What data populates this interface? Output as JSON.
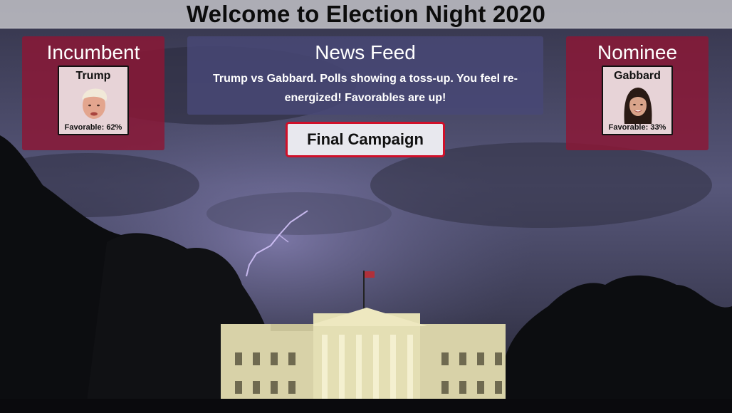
{
  "title": "Welcome to Election Night 2020",
  "incumbent": {
    "heading": "Incumbent",
    "name": "Trump",
    "favorable_label": "Favorable: 62%",
    "favorable": 62
  },
  "nominee": {
    "heading": "Nominee",
    "name": "Gabbard",
    "favorable_label": "Favorable: 33%",
    "favorable": 33
  },
  "news_feed": {
    "heading": "News Feed",
    "text": "Trump vs Gabbard. Polls showing a toss-up. You feel re-energized! Favorables are up!"
  },
  "action_button": "Final Campaign",
  "colors": {
    "panel": "#8c1634",
    "news_panel": "#484876",
    "button_border": "#d0102a"
  }
}
